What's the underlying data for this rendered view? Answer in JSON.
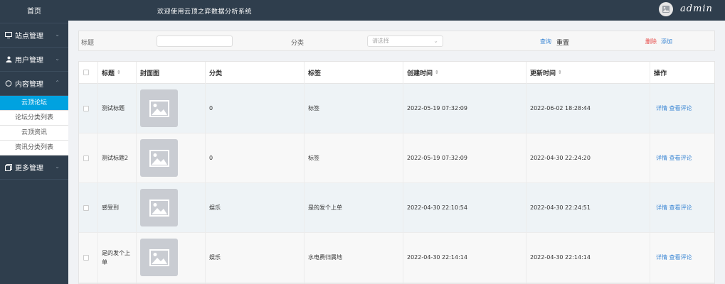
{
  "sidebar": {
    "home": "首页",
    "groups": [
      {
        "label": "站点管理",
        "icon": "monitor-icon"
      },
      {
        "label": "用户管理",
        "icon": "user-icon"
      },
      {
        "label": "内容管理",
        "icon": "comment-icon"
      },
      {
        "label": "更多管理",
        "icon": "copy-icon"
      }
    ],
    "content_items": [
      {
        "label": "云顶论坛",
        "active": true
      },
      {
        "label": "论坛分类列表",
        "active": false
      },
      {
        "label": "云顶资讯",
        "active": false
      },
      {
        "label": "资讯分类列表",
        "active": false
      }
    ]
  },
  "header": {
    "welcome": "欢迎使用云顶之弈数据分析系统",
    "user": "admin"
  },
  "search": {
    "title_label": "标题",
    "category_label": "分类",
    "category_placeholder": "请选择",
    "query": "查询",
    "reset": "重置",
    "delete": "删除",
    "add": "添加"
  },
  "table": {
    "headers": [
      "标题",
      "封面图",
      "分类",
      "标签",
      "创建时间",
      "更新时间",
      "操作"
    ],
    "rows": [
      {
        "title": "测试标题",
        "category": "0",
        "tag": "标签",
        "created": "2022-05-19 07:32:09",
        "updated": "2022-06-02 18:28:44",
        "op1": "详情",
        "op2": "查看评论"
      },
      {
        "title": "测试标题2",
        "category": "0",
        "tag": "标签",
        "created": "2022-05-19 07:32:09",
        "updated": "2022-04-30 22:24:20",
        "op1": "详情",
        "op2": "查看评论"
      },
      {
        "title": "感受到",
        "category": "娱乐",
        "tag": "是的发个上单",
        "created": "2022-04-30 22:10:54",
        "updated": "2022-04-30 22:24:51",
        "op1": "详情",
        "op2": "查看评论"
      },
      {
        "title": "是的发个上单",
        "category": "娱乐",
        "tag": "水电费归属地",
        "created": "2022-04-30 22:14:14",
        "updated": "2022-04-30 22:14:14",
        "op1": "详情",
        "op2": "查看评论"
      }
    ]
  }
}
